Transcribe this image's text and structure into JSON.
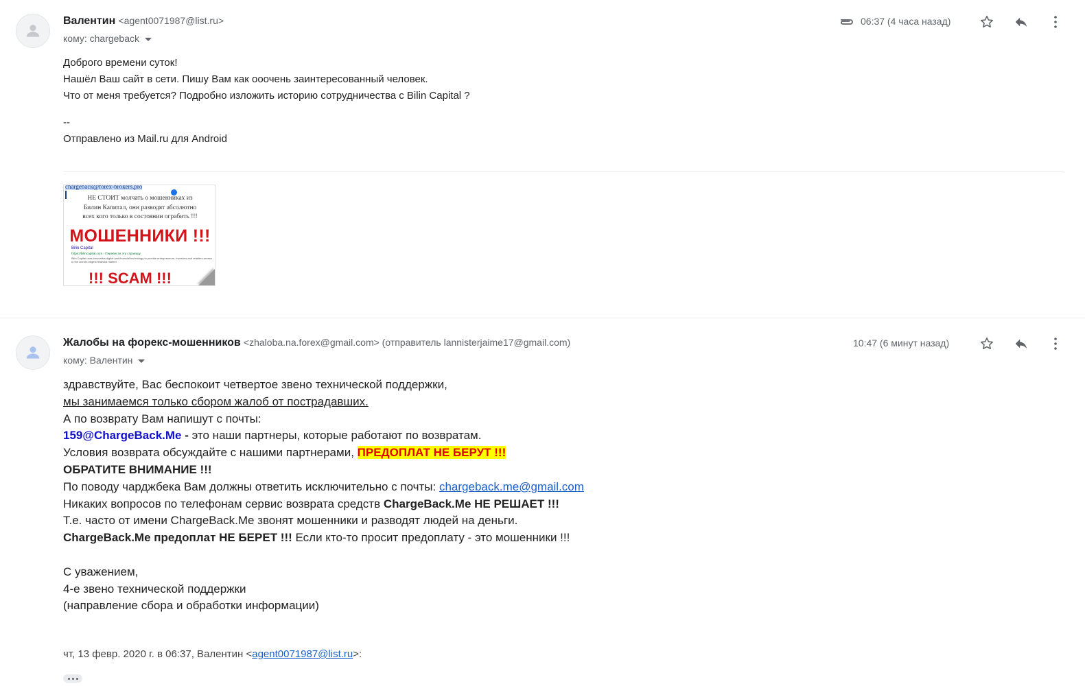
{
  "message1": {
    "sender_name": "Валентин",
    "sender_email": "<agent0071987@list.ru>",
    "to_label": "кому: chargeback",
    "time": "06:37 (4 часа назад)",
    "body": [
      "Доброго времени суток!",
      "Нашёл Ваш сайт в сети. Пишу Вам как ооочень заинтересованный человек.",
      "Что от меня требуется? Подробно изложить историю сотрудничества с Bilin Capital ?",
      "",
      "--",
      "Отправлено из Mail.ru для Android"
    ],
    "attachment": {
      "header_email": "chargeback@forex-brokers.pro",
      "warning_text_1": "НЕ СТОИТ молчать о мошенниках из",
      "warning_text_2": "Билин Капитал, они разводят абсолютно",
      "warning_text_3": "всех кого только в состоянии ограбить !!!",
      "big_title": "МОШЕННИКИ !!!",
      "site_name": "Bilin Capital",
      "site_url": "https://bilincapital.com › Перевести эту страницу",
      "site_desc": "Bilin Capital uses innovative digital and financial technology to provide entrepreneurs, investors and retailers access to the world's largest financial market.",
      "scam_label": "!!! SCAM !!!"
    }
  },
  "message2": {
    "sender_name": "Жалобы на форекс-мошенников",
    "sender_email": "<zhaloba.na.forex@gmail.com> (отправитель lannisterjaime17@gmail.com)",
    "to_label": "кому: Валентин",
    "time": "10:47 (6 минут назад)",
    "line1": "здравствуйте, Вас беспокоит четвертое звено технической поддержки,",
    "line2": "мы занимаемся только сбором жалоб от пострадавших.",
    "line3": "А по возврату Вам напишут с почты:",
    "line4_email": "159@ChargeBack.Me",
    "line4_dash": " - ",
    "line4_rest": "это наши партнеры, которые работают по возвратам.",
    "line5_text": "Условия возврата обсуждайте с нашими партнерами, ",
    "line5_highlight": "ПРЕДОПЛАТ НЕ БЕРУТ !!!",
    "line6": "ОБРАТИТЕ ВНИМАНИЕ !!!",
    "line7_text": "По поводу чарджбека Вам должны ответить исключительно с почты: ",
    "line7_link": "chargeback.me@gmail.com",
    "line8_text": "Никаких вопросов по телефонам сервис возврата средств ",
    "line8_bold": "ChargeBack.Me НЕ РЕШАЕТ !!!",
    "line9": "Т.е. часто от имени ChargeBack.Me звонят мошенники и разводят людей на деньги.",
    "line10_bold": "ChargeBack.Me предоплат НЕ БЕРЕТ !!!",
    "line10_rest": " Если кто-то просит предоплату - это мошенники !!!",
    "sign1": "С уважением,",
    "sign2": "4-е звено технической поддержки",
    "sign3": "(направление сбора и обработки информации)",
    "quote_prefix": "чт, 13 февр. 2020 г. в 06:37, Валентин <",
    "quote_link": "agent0071987@list.ru",
    "quote_suffix": ">:"
  },
  "icons": [
    "person-icon",
    "paperclip-icon",
    "star-icon",
    "reply-icon",
    "more-vert-icon",
    "caret-down-icon",
    "ellipsis-icon"
  ]
}
